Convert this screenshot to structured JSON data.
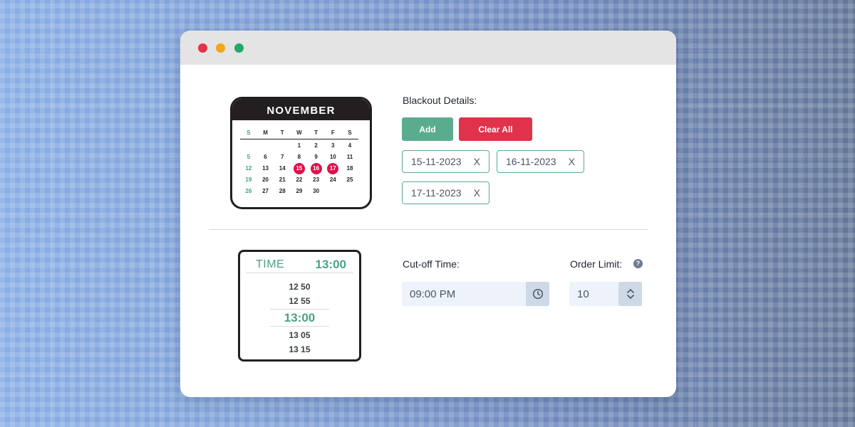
{
  "window": {
    "controls": {
      "close_color": "#e8324a",
      "minimize_color": "#f2a516",
      "maximize_color": "#22a86b"
    }
  },
  "calendar": {
    "month": "NOVEMBER",
    "weekdays": [
      "S",
      "M",
      "T",
      "W",
      "T",
      "F",
      "S"
    ],
    "weeks": [
      [
        "",
        "",
        "",
        "1",
        "2",
        "3",
        "4"
      ],
      [
        "5",
        "6",
        "7",
        "8",
        "9",
        "10",
        "11"
      ],
      [
        "12",
        "13",
        "14",
        "15",
        "16",
        "17",
        "18"
      ],
      [
        "19",
        "20",
        "21",
        "22",
        "23",
        "24",
        "25"
      ],
      [
        "26",
        "27",
        "28",
        "29",
        "30",
        "",
        ""
      ]
    ],
    "selected_days": [
      "15",
      "16",
      "17"
    ],
    "selected_color": "#e0104a",
    "sunday_color": "#3aa47c"
  },
  "blackout": {
    "label": "Blackout Details:",
    "add_label": "Add",
    "clear_label": "Clear All",
    "add_color": "#5aac8e",
    "clear_color": "#e0324a",
    "dates": [
      {
        "date": "15-11-2023",
        "remove": "X"
      },
      {
        "date": "16-11-2023",
        "remove": "X"
      },
      {
        "date": "17-11-2023",
        "remove": "X"
      }
    ]
  },
  "timepicker": {
    "label": "TIME",
    "current": "13:00",
    "options": [
      "12 50",
      "12 55",
      "13:00",
      "13 05",
      "13 15"
    ]
  },
  "cutoff": {
    "label": "Cut-off Time:",
    "value": "09:00 PM",
    "icon": "clock-icon"
  },
  "order_limit": {
    "label": "Order Limit:",
    "help": "?",
    "value": "10",
    "icon": "stepper-chevrons-icon"
  }
}
